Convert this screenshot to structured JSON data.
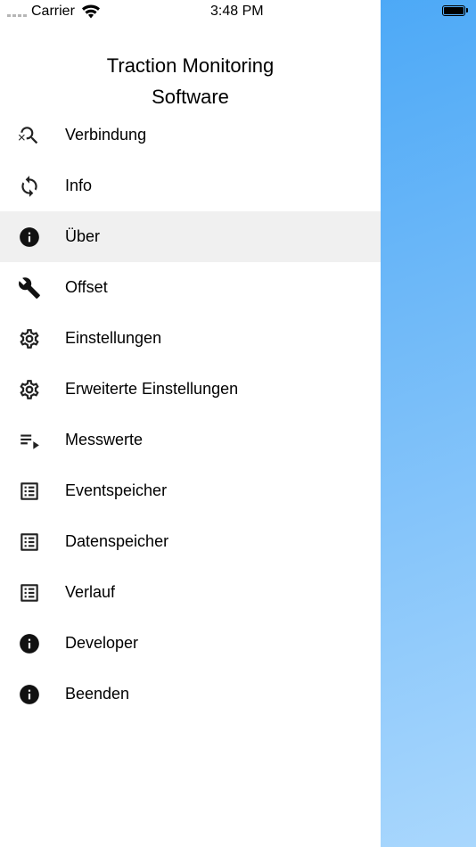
{
  "status_bar": {
    "carrier": "Carrier",
    "time": "3:48 PM"
  },
  "header": {
    "title_line1": "Traction Monitoring",
    "title_line2": "Software"
  },
  "menu": {
    "items": [
      {
        "label": "Verbindung",
        "icon": "search-refresh-icon"
      },
      {
        "label": "Info",
        "icon": "sync-icon"
      },
      {
        "label": "Über",
        "icon": "info-icon",
        "selected": true
      },
      {
        "label": "Offset",
        "icon": "wrench-icon"
      },
      {
        "label": "Einstellungen",
        "icon": "gear-icon"
      },
      {
        "label": "Erweiterte Einstellungen",
        "icon": "gear-icon"
      },
      {
        "label": "Messwerte",
        "icon": "playlist-icon"
      },
      {
        "label": "Eventspeicher",
        "icon": "list-icon"
      },
      {
        "label": "Datenspeicher",
        "icon": "list-icon"
      },
      {
        "label": "Verlauf",
        "icon": "list-icon"
      },
      {
        "label": "Developer",
        "icon": "info-icon"
      },
      {
        "label": "Beenden",
        "icon": "info-icon"
      }
    ]
  },
  "colors": {
    "selected_row": "#f0f0f0",
    "background_gradient_start": "#3ea2f6",
    "background_gradient_end": "#a9d7fd",
    "icon": "#222222"
  }
}
